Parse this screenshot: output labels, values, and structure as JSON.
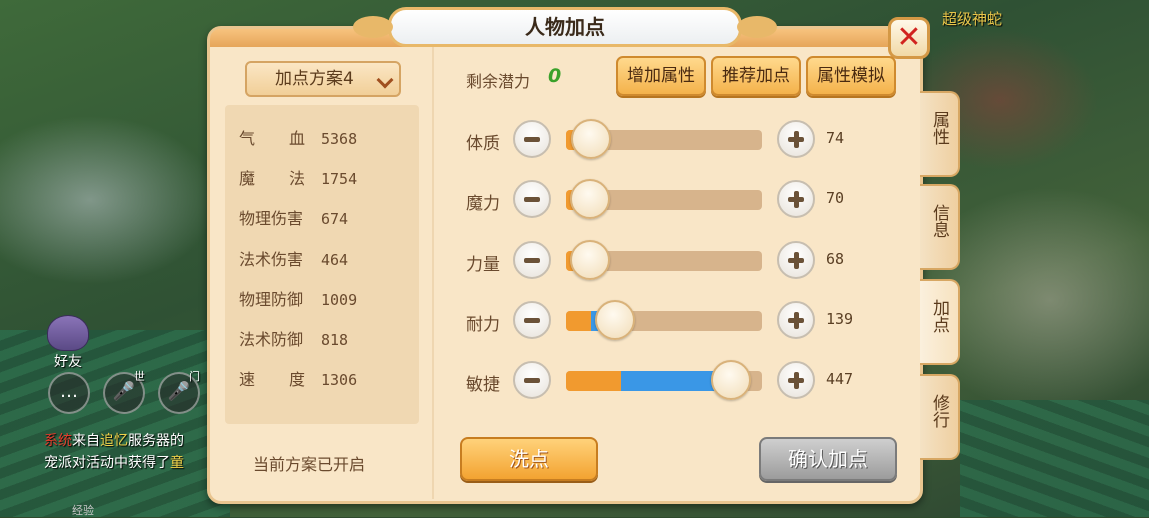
{
  "background": {
    "boss_name": "超级神蛇",
    "friend_label": "好友",
    "voice_tag_world": "世",
    "voice_tag_team": "门",
    "chat": [
      {
        "tag": "系统",
        "text_a": "来自",
        "highlight": "追忆",
        "text_b": "服务器的"
      },
      {
        "tag": "",
        "text_a": "宠派对活动中获得了",
        "highlight": "童",
        "text_b": ""
      }
    ],
    "bottom_hint": "经验"
  },
  "window": {
    "title": "人物加点",
    "close_label": "✕"
  },
  "left": {
    "scheme_dropdown": "加点方案4",
    "stats": [
      {
        "label": "气血",
        "value": "5368"
      },
      {
        "label": "魔法",
        "value": "1754"
      },
      {
        "label": "物理伤害",
        "value": "674"
      },
      {
        "label": "法术伤害",
        "value": "464"
      },
      {
        "label": "物理防御",
        "value": "1009"
      },
      {
        "label": "法术防御",
        "value": "818"
      },
      {
        "label": "速度",
        "value": "1306"
      }
    ],
    "scheme_status": "当前方案已开启"
  },
  "right": {
    "potential_label": "剩余潜力",
    "potential_value": "0",
    "buttons": {
      "add_attr": "增加属性",
      "recommend": "推荐加点",
      "simulate": "属性模拟"
    },
    "attributes": [
      {
        "label": "体质",
        "value": "74",
        "fill_base": 0.05,
        "fill_add": 0.0,
        "knob": 0.13
      },
      {
        "label": "魔力",
        "value": "70",
        "fill_base": 0.05,
        "fill_add": 0.0,
        "knob": 0.12
      },
      {
        "label": "力量",
        "value": "68",
        "fill_base": 0.05,
        "fill_add": 0.0,
        "knob": 0.12
      },
      {
        "label": "耐力",
        "value": "139",
        "fill_base": 0.13,
        "fill_add": 0.12,
        "knob": 0.25
      },
      {
        "label": "敏捷",
        "value": "447",
        "fill_base": 0.28,
        "fill_add": 0.56,
        "knob": 0.84
      }
    ],
    "reset_label": "洗点",
    "confirm_label": "确认加点"
  },
  "side_tabs": [
    {
      "label": "属性",
      "active": false
    },
    {
      "label": "信息",
      "active": false
    },
    {
      "label": "加点",
      "active": true
    },
    {
      "label": "修行",
      "active": false
    }
  ],
  "colors": {
    "panel": "#f9e6c7",
    "fill_base": "#f19a2f",
    "fill_add": "#3a97e6",
    "potential": "#3aa12a",
    "close_x": "#d1231f"
  }
}
